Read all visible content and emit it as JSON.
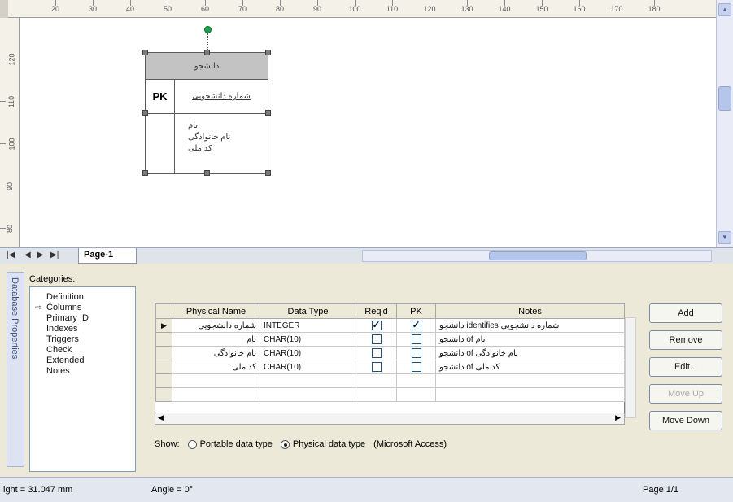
{
  "ruler": {
    "top_numbers": [
      "20",
      "30",
      "40",
      "50",
      "60",
      "70",
      "80",
      "90",
      "100",
      "110",
      "120",
      "130",
      "140",
      "150",
      "160",
      "170",
      "180"
    ],
    "left_numbers": [
      "120",
      "110",
      "100",
      "90",
      "80"
    ]
  },
  "entity": {
    "name": "دانشجو",
    "pk_label": "PK",
    "pk_attribute": "شماره دانشجویی",
    "attributes": [
      "نام",
      "نام خانوادگی",
      "کد ملی"
    ]
  },
  "pagebar": {
    "nav_first": "|◀",
    "nav_prev": "◀",
    "nav_next": "▶",
    "nav_last": "▶|",
    "page_tab": "Page-1"
  },
  "props": {
    "side_title": "Database Properties",
    "categories_label": "Categories:",
    "categories": [
      "Definition",
      "Columns",
      "Primary ID",
      "Indexes",
      "Triggers",
      "Check",
      "Extended",
      "Notes"
    ],
    "selected_category": "Columns",
    "grid": {
      "headers": [
        "Physical Name",
        "Data Type",
        "Req'd",
        "PK",
        "Notes"
      ],
      "rows": [
        {
          "name": "شماره دانشجویی",
          "type": "INTEGER",
          "reqd": true,
          "pk": true,
          "notes": "دانشجو identifies شماره دانشجویی"
        },
        {
          "name": "نام",
          "type": "CHAR(10)",
          "reqd": false,
          "pk": false,
          "notes": "دانشجو of نام"
        },
        {
          "name": "نام خانوادگی",
          "type": "CHAR(10)",
          "reqd": false,
          "pk": false,
          "notes": "دانشجو of نام خانوادگی"
        },
        {
          "name": "کد ملی",
          "type": "CHAR(10)",
          "reqd": false,
          "pk": false,
          "notes": "دانشجو of کد ملی"
        }
      ]
    },
    "buttons": {
      "add": "Add",
      "remove": "Remove",
      "edit": "Edit...",
      "move_up": "Move Up",
      "move_down": "Move Down"
    },
    "show_label": "Show:",
    "radio_portable": "Portable data type",
    "radio_physical": "Physical data type",
    "db_note": "(Microsoft Access)"
  },
  "status": {
    "height": "ight = 31.047 mm",
    "angle": "Angle = 0°",
    "page": "Page 1/1"
  }
}
